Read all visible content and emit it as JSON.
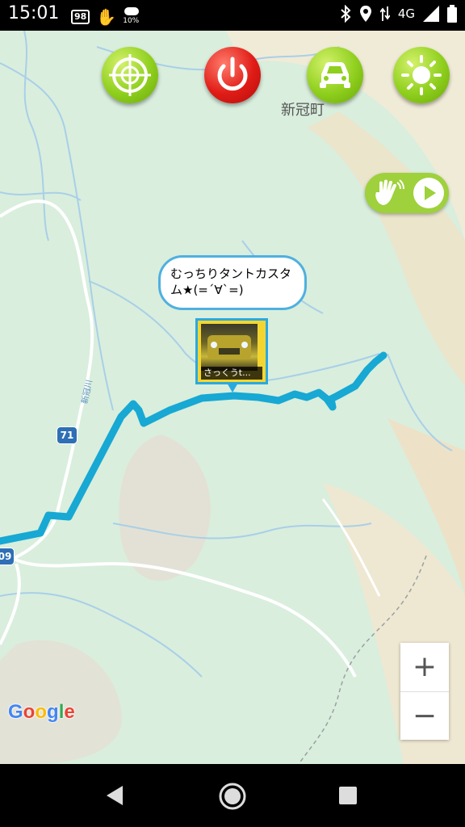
{
  "status_bar": {
    "time": "15:01",
    "badge": "98",
    "weather_pct": "10%",
    "network": "4G"
  },
  "map": {
    "town_label": "新冠町",
    "river_label": "新冠川",
    "route_shield_main": "71",
    "route_shield_edge": "09",
    "attribution": [
      "G",
      "o",
      "o",
      "g",
      "l",
      "e"
    ],
    "attribution_colors": [
      "#4285F4",
      "#EA4335",
      "#FBBC05",
      "#4285F4",
      "#34A853",
      "#EA4335"
    ]
  },
  "toolbar": {
    "target_icon": "crosshair-icon",
    "power_icon": "power-icon",
    "car_icon": "car-icon",
    "brightness_icon": "sun-icon"
  },
  "play_toggle": {
    "hand_icon": "hand-icon",
    "play_icon": "play-icon"
  },
  "user_marker": {
    "bubble_text": "むっちりタントカスタム★(=´∀`=)",
    "caption": "さっくうt..."
  },
  "zoom": {
    "in_label": "+",
    "out_label": "−"
  },
  "colors": {
    "route": "#17a8d4",
    "fab_green": "#8fcf1d",
    "fab_red": "#e01c16",
    "bubble_border": "#4fb0e0"
  }
}
